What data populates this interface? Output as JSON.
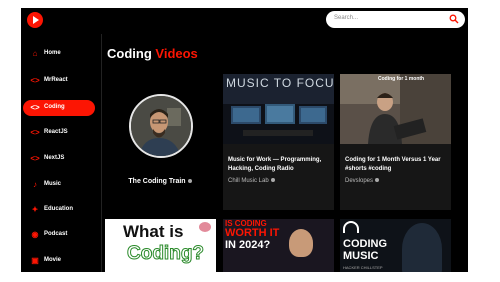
{
  "search": {
    "placeholder": "Search..."
  },
  "sidebar": {
    "items": [
      {
        "label": "Home",
        "icon": "home-icon",
        "glyph": "⌂",
        "active": false
      },
      {
        "label": "MrReact",
        "icon": "code-icon",
        "glyph": "<>",
        "active": false
      },
      {
        "label": "Coding",
        "icon": "code-icon",
        "glyph": "<>",
        "active": true
      },
      {
        "label": "ReactJS",
        "icon": "code-icon",
        "glyph": "<>",
        "active": false
      },
      {
        "label": "NextJS",
        "icon": "code-icon",
        "glyph": "<>",
        "active": false
      },
      {
        "label": "Music",
        "icon": "music-note-icon",
        "glyph": "♪",
        "active": false
      },
      {
        "label": "Education",
        "icon": "graduation-cap-icon",
        "glyph": "✦",
        "active": false
      },
      {
        "label": "Podcast",
        "icon": "podcast-icon",
        "glyph": "◉",
        "active": false
      },
      {
        "label": "Movie",
        "icon": "movie-icon",
        "glyph": "▣",
        "active": false
      }
    ]
  },
  "main": {
    "title_main": "Coding",
    "title_accent": "Videos",
    "channel": {
      "name": "The Coding Train"
    },
    "videos": [
      {
        "thumb_text": "MUSIC TO FOCU",
        "title": "Music for Work — Programming, Hacking, Coding Radio",
        "channel": "Chill Music Lab"
      },
      {
        "thumb_text": "Coding for 1 month",
        "title": "Coding for 1 Month Versus 1 Year #shorts #coding",
        "channel": "Devslopes"
      }
    ],
    "bottom_thumbs": [
      {
        "line1": "What is",
        "line2": "Coding?"
      },
      {
        "line1": "IS CODING",
        "line2": "WORTH IT",
        "line3": "IN 2024?"
      },
      {
        "line1": "CODING",
        "line2": "MUSIC",
        "line3": "HACKER CHILLSTEP"
      }
    ]
  },
  "colors": {
    "accent": "#fc1503",
    "background": "#000000",
    "card": "#161616"
  }
}
